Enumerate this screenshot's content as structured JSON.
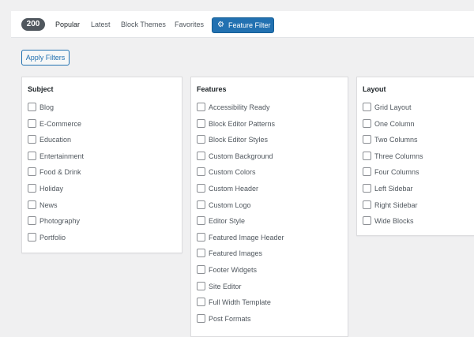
{
  "filter_bar": {
    "count": "200",
    "tabs": [
      "Popular",
      "Latest",
      "Block Themes",
      "Favorites"
    ],
    "feature_filter_label": "Feature Filter",
    "feature_filter_icon": "gear-icon"
  },
  "apply_filters_label": "Apply Filters",
  "groups": {
    "subject": {
      "title": "Subject",
      "options": [
        "Blog",
        "E-Commerce",
        "Education",
        "Entertainment",
        "Food & Drink",
        "Holiday",
        "News",
        "Photography",
        "Portfolio"
      ]
    },
    "features": {
      "title": "Features",
      "options": [
        "Accessibility Ready",
        "Block Editor Patterns",
        "Block Editor Styles",
        "Custom Background",
        "Custom Colors",
        "Custom Header",
        "Custom Logo",
        "Editor Style",
        "Featured Image Header",
        "Featured Images",
        "Footer Widgets",
        "Site Editor",
        "Full Width Template",
        "Post Formats"
      ]
    },
    "layout": {
      "title": "Layout",
      "options": [
        "Grid Layout",
        "One Column",
        "Two Columns",
        "Three Columns",
        "Four Columns",
        "Left Sidebar",
        "Right Sidebar",
        "Wide Blocks"
      ]
    }
  },
  "colors": {
    "accent": "#2271b1",
    "badge": "#50575e",
    "background": "#f0f0f1"
  }
}
